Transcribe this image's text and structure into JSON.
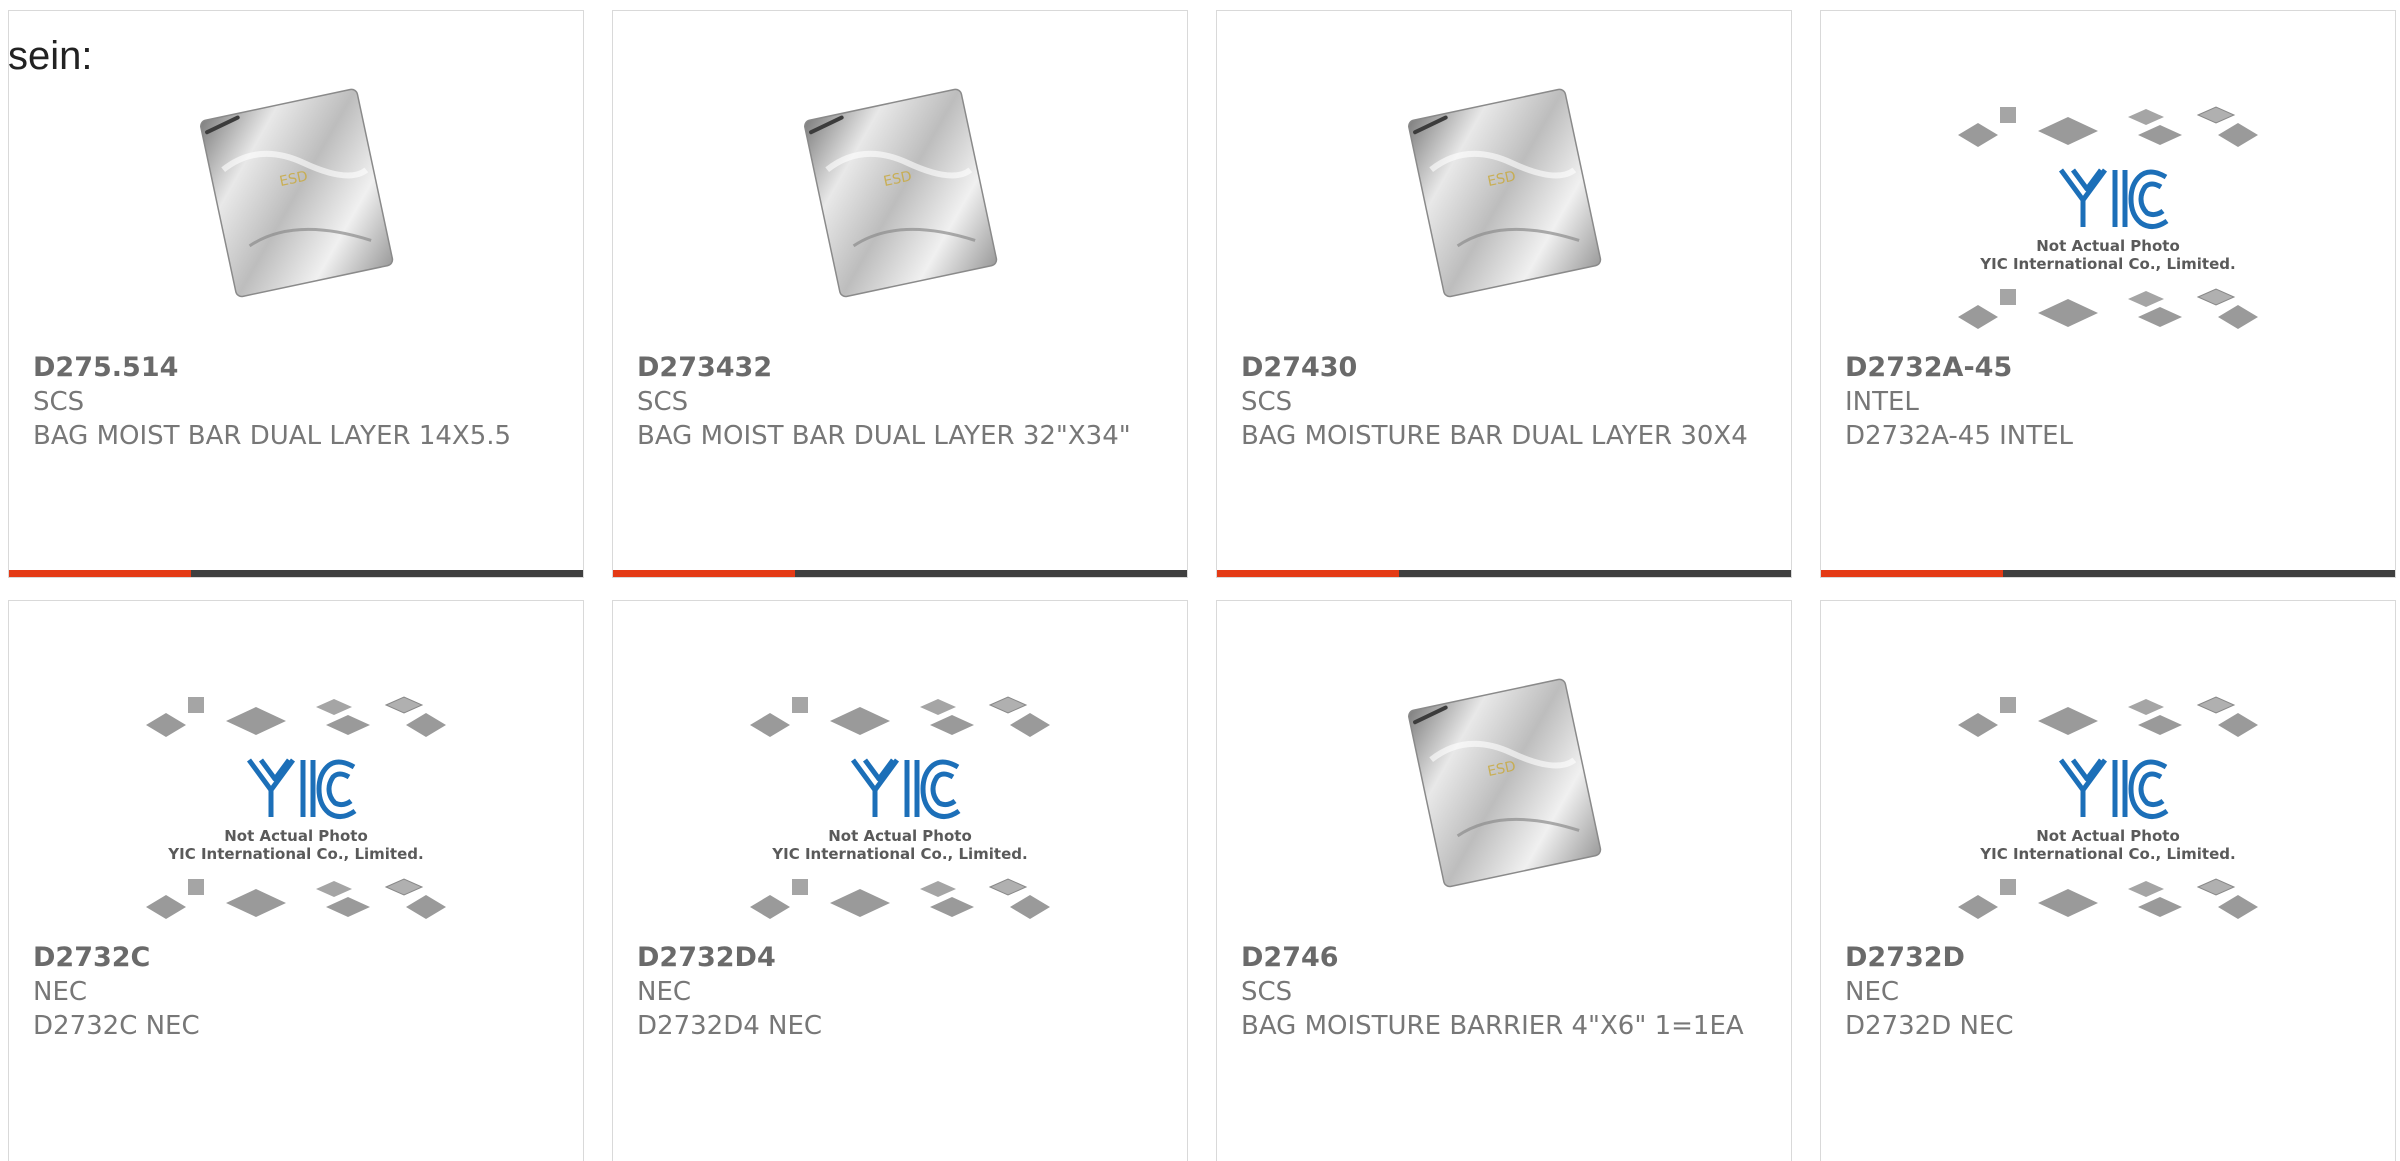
{
  "heading": "sein:",
  "colors": {
    "accent": "#e43a15",
    "bar": "#3f3f3f",
    "border": "#d9d9d9",
    "text": "#777777"
  },
  "products": [
    {
      "part": "D275.514",
      "mfr": "SCS",
      "desc": "BAG MOIST BAR DUAL LAYER 14X5.5",
      "image": "esd-bag",
      "show_bar": true
    },
    {
      "part": "D273432",
      "mfr": "SCS",
      "desc": "BAG MOIST BAR DUAL LAYER 32\"X34\"",
      "image": "esd-bag",
      "show_bar": true
    },
    {
      "part": "D27430",
      "mfr": "SCS",
      "desc": "BAG MOISTURE BAR DUAL LAYER 30X4",
      "image": "esd-bag",
      "show_bar": true
    },
    {
      "part": "D2732A-45",
      "mfr": "INTEL",
      "desc": "D2732A-45 INTEL",
      "image": "not-actual-photo",
      "show_bar": true
    },
    {
      "part": "D2732C",
      "mfr": "NEC",
      "desc": "D2732C NEC",
      "image": "not-actual-photo",
      "show_bar": false
    },
    {
      "part": "D2732D4",
      "mfr": "NEC",
      "desc": "D2732D4 NEC",
      "image": "not-actual-photo",
      "show_bar": false
    },
    {
      "part": "D2746",
      "mfr": "SCS",
      "desc": "BAG MOISTURE BARRIER 4\"X6\" 1=1EA",
      "image": "esd-bag",
      "show_bar": false
    },
    {
      "part": "D2732D",
      "mfr": "NEC",
      "desc": "D2732D NEC",
      "image": "not-actual-photo",
      "show_bar": false
    }
  ],
  "placeholder": {
    "logo_text": "YIC",
    "line1": "Not Actual Photo",
    "line2": "YIC International Co., Limited."
  }
}
